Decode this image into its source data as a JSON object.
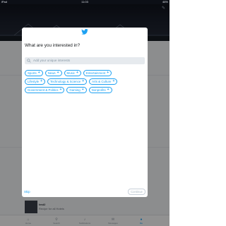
{
  "status_bar": {
    "carrier": "iPad",
    "time": "11:03",
    "battery": "46%"
  },
  "background": {
    "feed_item": {
      "title": "test2",
      "subtitle": "Recipe for all Hotels"
    },
    "tabs": [
      {
        "label": "Home",
        "icon": "home-icon"
      },
      {
        "label": "Search",
        "icon": "search-icon"
      },
      {
        "label": "Notifications",
        "icon": "bell-icon"
      },
      {
        "label": "Messages",
        "icon": "envelope-icon"
      },
      {
        "label": "Me",
        "icon": "person-icon"
      }
    ]
  },
  "modal": {
    "logo": "twitter-bird-icon",
    "title": "What are you interested in?",
    "search_placeholder": "Add your unique interests",
    "interest_rows": [
      [
        "Sports",
        "News",
        "Music",
        "Entertainment"
      ],
      [
        "Lifestyle",
        "Technology & Science",
        "Arts & Culture"
      ],
      [
        "Government & Politics",
        "Gaming",
        "Nonprofits"
      ]
    ],
    "chip_plus": "+",
    "skip_label": "Skip",
    "continue_label": "Continue"
  },
  "colors": {
    "accent": "#1da1f2",
    "overlay": "rgba(0,0,0,0.42)",
    "modal_bg": "#ffffff"
  }
}
